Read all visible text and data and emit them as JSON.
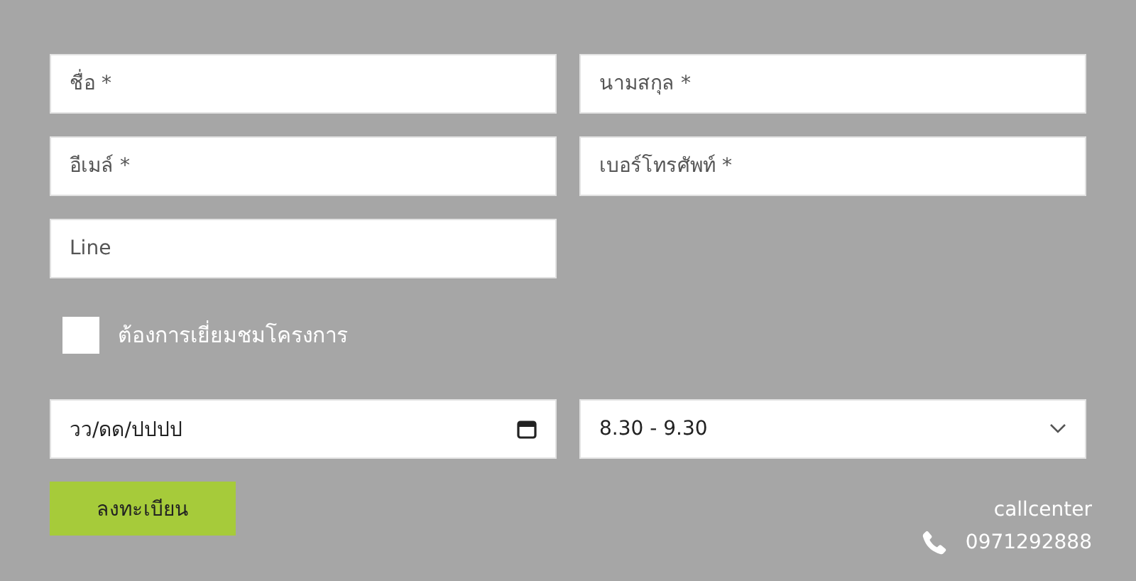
{
  "fields": [
    {
      "placeholder": "ชื่อ *"
    },
    {
      "placeholder": "นามสกุล *"
    },
    {
      "placeholder": "อีเมล์ *"
    },
    {
      "placeholder": "เบอร์โทรศัพท์ *"
    },
    {
      "placeholder": "Line"
    }
  ],
  "visit_checkbox": {
    "label": "ต้องการเยี่ยมชมโครงการ",
    "checked": false
  },
  "date_field": {
    "placeholder": "วว/ดด/ปปปป"
  },
  "time_select": {
    "value": "8.30 - 9.30"
  },
  "submit_button": {
    "label": "ลงทะเบียน"
  },
  "contact": {
    "title": "callcenter",
    "phone": "0971292888"
  }
}
